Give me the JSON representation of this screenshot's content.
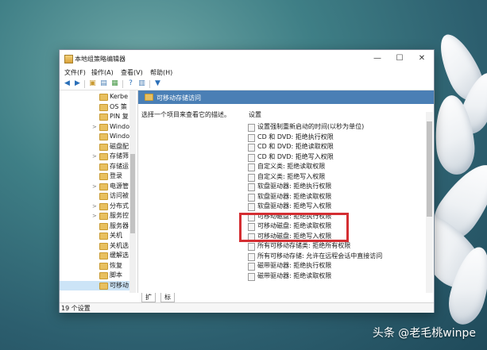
{
  "window": {
    "title": "本地组策略编辑器",
    "controls": {
      "minimize": "—",
      "maximize": "☐",
      "close": "✕"
    }
  },
  "menubar": [
    "文件(F)",
    "操作(A)",
    "查看(V)",
    "帮助(H)"
  ],
  "tree": {
    "items": [
      {
        "label": "Kerbe",
        "expander": ""
      },
      {
        "label": "OS 策",
        "expander": ""
      },
      {
        "label": "PIN 复",
        "expander": ""
      },
      {
        "label": "Windo",
        "expander": ">"
      },
      {
        "label": "Windo",
        "expander": ""
      },
      {
        "label": "磁盘配",
        "expander": ""
      },
      {
        "label": "存储筛",
        "expander": ">"
      },
      {
        "label": "存储运",
        "expander": ""
      },
      {
        "label": "登录",
        "expander": ""
      },
      {
        "label": "电源管",
        "expander": ">"
      },
      {
        "label": "访问被",
        "expander": ""
      },
      {
        "label": "分布式",
        "expander": ">"
      },
      {
        "label": "服务控",
        "expander": ">"
      },
      {
        "label": "服务器",
        "expander": ""
      },
      {
        "label": "关机",
        "expander": ""
      },
      {
        "label": "关机选",
        "expander": ""
      },
      {
        "label": "缓解选",
        "expander": ""
      },
      {
        "label": "恢复",
        "expander": ""
      },
      {
        "label": "脚本",
        "expander": ""
      },
      {
        "label": "可移动",
        "expander": ""
      }
    ]
  },
  "content": {
    "header": "可移动存储访问",
    "description": "选择一个项目来查看它的描述。",
    "column_header": "设置",
    "settings": [
      "设置强制重新启动的时间(以秒为单位)",
      "CD 和 DVD: 拒绝执行权限",
      "CD 和 DVD: 拒绝读取权限",
      "CD 和 DVD: 拒绝写入权限",
      "自定义类: 拒绝读取权限",
      "自定义类: 拒绝写入权限",
      "软盘驱动器: 拒绝执行权限",
      "软盘驱动器: 拒绝读取权限",
      "软盘驱动器: 拒绝写入权限",
      "可移动磁盘: 拒绝执行权限",
      "可移动磁盘: 拒绝读取权限",
      "可移动磁盘: 拒绝写入权限",
      "所有可移动存储类: 拒绝所有权限",
      "所有可移动存储: 允许在远程会话中直接访问",
      "磁带驱动器: 拒绝执行权限",
      "磁带驱动器: 拒绝读取权限"
    ]
  },
  "tabs": [
    "扩展",
    "标准"
  ],
  "status": "19 个设置",
  "watermark": "头条 @老毛桃winpe",
  "colors": {
    "header_blue": "#4a7fb5",
    "highlight_red": "#d42e32",
    "selection": "#cce4f7"
  }
}
